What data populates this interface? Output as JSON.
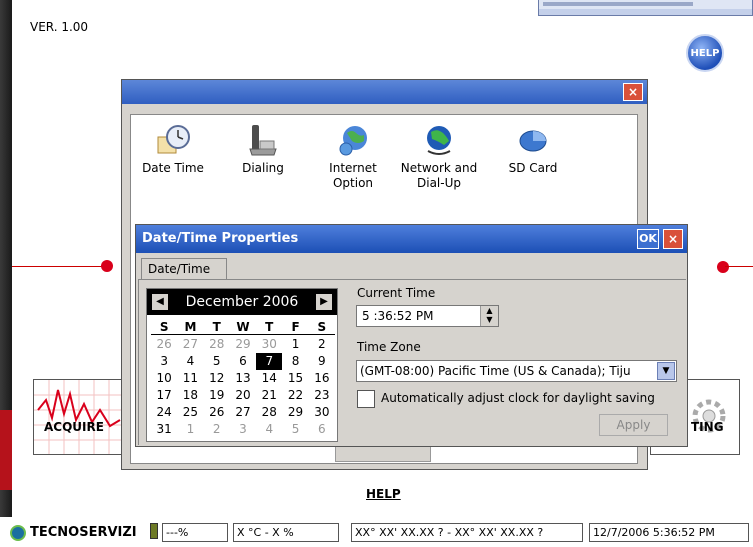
{
  "app": {
    "version": "VER. 1.00"
  },
  "top_right_help": {
    "label": "HELP"
  },
  "control_panel": {
    "items": [
      {
        "label_lines": [
          "Date Time"
        ],
        "icon": "clock-icon"
      },
      {
        "label_lines": [
          "Dialing"
        ],
        "icon": "phone-icon"
      },
      {
        "label_lines": [
          "Internet",
          "Option"
        ],
        "icon": "globe-icon"
      },
      {
        "label_lines": [
          "Network and",
          "Dial-Up"
        ],
        "icon": "network-icon"
      },
      {
        "label_lines": [
          "SD Card"
        ],
        "icon": "sd-card-icon"
      }
    ]
  },
  "buttons": {
    "acquire": "ACQUIRE",
    "setting": "TING"
  },
  "datetime_dialog": {
    "title": "Date/Time Properties",
    "ok_label": "OK",
    "close_label": "×",
    "tab_label": "Date/Time",
    "calendar": {
      "month_year": "December 2006",
      "days_of_week": [
        "S",
        "M",
        "T",
        "W",
        "T",
        "F",
        "S"
      ],
      "weeks": [
        [
          [
            "26",
            1
          ],
          [
            "27",
            1
          ],
          [
            "28",
            1
          ],
          [
            "29",
            1
          ],
          [
            "30",
            1
          ],
          [
            "1",
            0
          ],
          [
            "2",
            0
          ]
        ],
        [
          [
            "3",
            0
          ],
          [
            "4",
            0
          ],
          [
            "5",
            0
          ],
          [
            "6",
            0
          ],
          [
            "7",
            2
          ],
          [
            "8",
            0
          ],
          [
            "9",
            0
          ]
        ],
        [
          [
            "10",
            0
          ],
          [
            "11",
            0
          ],
          [
            "12",
            0
          ],
          [
            "13",
            0
          ],
          [
            "14",
            0
          ],
          [
            "15",
            0
          ],
          [
            "16",
            0
          ]
        ],
        [
          [
            "17",
            0
          ],
          [
            "18",
            0
          ],
          [
            "19",
            0
          ],
          [
            "20",
            0
          ],
          [
            "21",
            0
          ],
          [
            "22",
            0
          ],
          [
            "23",
            0
          ]
        ],
        [
          [
            "24",
            0
          ],
          [
            "25",
            0
          ],
          [
            "26",
            0
          ],
          [
            "27",
            0
          ],
          [
            "28",
            0
          ],
          [
            "29",
            0
          ],
          [
            "30",
            0
          ]
        ],
        [
          [
            "31",
            0
          ],
          [
            "1",
            1
          ],
          [
            "2",
            1
          ],
          [
            "3",
            1
          ],
          [
            "4",
            1
          ],
          [
            "5",
            1
          ],
          [
            "6",
            1
          ]
        ]
      ]
    },
    "current_time_label": "Current Time",
    "current_time_value": "5 :36:52 PM",
    "time_zone_label": "Time Zone",
    "time_zone_value": "(GMT-08:00) Pacific Time (US & Canada); Tiju",
    "dst_label": "Automatically adjust clock for daylight saving",
    "dst_checked": false,
    "apply_label": "Apply"
  },
  "help_link": "HELP",
  "status_bar": {
    "brand": "TECNOSERVIZI",
    "battery": "---%",
    "temperature": "X °C - X %",
    "coordinates": "XX° XX' XX.XX ? - XX° XX' XX.XX ?",
    "datetime": "12/7/2006 5:36:52 PM"
  },
  "colors": {
    "titlebar": "#2f5ec1",
    "close_button": "#d9513a",
    "accent_dot": "#d9001b"
  }
}
